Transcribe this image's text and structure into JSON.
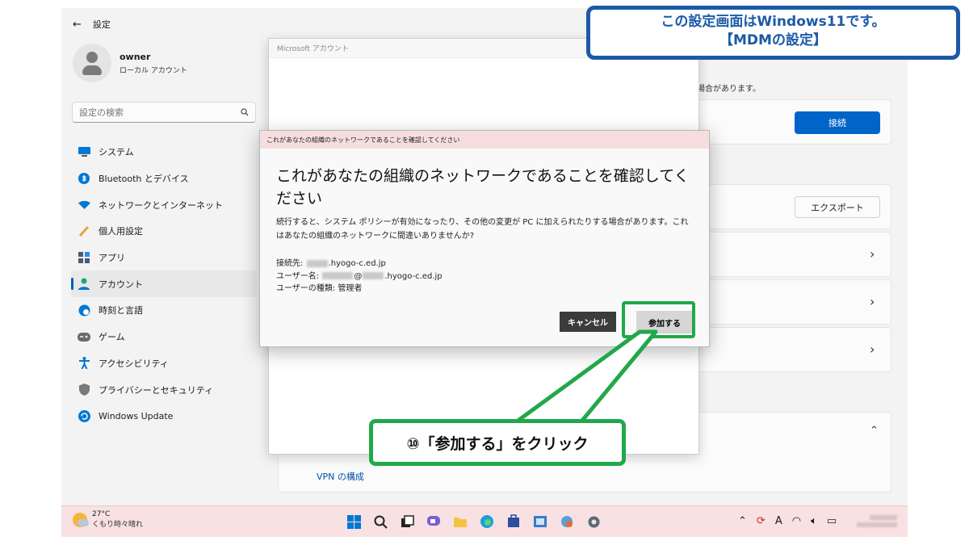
{
  "settings": {
    "back_label": "設定",
    "profile": {
      "name": "owner",
      "type": "ローカル アカウント"
    },
    "search_placeholder": "設定の検索",
    "nav": [
      {
        "label": "システム",
        "icon": "monitor-icon",
        "color": "#0078d4"
      },
      {
        "label": "Bluetooth とデバイス",
        "icon": "bluetooth-icon",
        "color": "#0078d4"
      },
      {
        "label": "ネットワークとインターネット",
        "icon": "wifi-icon",
        "color": "#0078d4"
      },
      {
        "label": "個人用設定",
        "icon": "brush-icon",
        "color": "#e8a33d"
      },
      {
        "label": "アプリ",
        "icon": "apps-icon",
        "color": "#4a5a78"
      },
      {
        "label": "アカウント",
        "icon": "person-icon",
        "color": "#1fa67a",
        "active": true
      },
      {
        "label": "時刻と言語",
        "icon": "globe-clock-icon",
        "color": "#0078d4"
      },
      {
        "label": "ゲーム",
        "icon": "gamepad-icon",
        "color": "#6b6b6b"
      },
      {
        "label": "アクセシビリティ",
        "icon": "accessibility-icon",
        "color": "#0078d4"
      },
      {
        "label": "プライバシーとセキュリティ",
        "icon": "shield-icon",
        "color": "#7a7a7a"
      },
      {
        "label": "Windows Update",
        "icon": "update-icon",
        "color": "#0078d4"
      }
    ],
    "hint_text": "場合があります。",
    "connect_label": "接続",
    "export_label": "エクスポート",
    "vpn_label": "VPN の構成"
  },
  "ms_account_window": {
    "title": "Microsoft アカウント"
  },
  "dialog": {
    "titlebar": "これがあなたの組織のネットワークであることを確認してください",
    "heading": "これがあなたの組織のネットワークであることを確認してください",
    "body": "続行すると、システム ポリシーが有効になったり、その他の変更が PC に加えられたりする場合があります。これはあなたの組織のネットワークに間違いありませんか?",
    "connect_to_label": "接続先:",
    "connect_to_domain": ".hyogo-c.ed.jp",
    "user_label": "ユーザー名:",
    "user_at": "@",
    "user_domain": ".hyogo-c.ed.jp",
    "user_type_label": "ユーザーの種類:",
    "user_type_value": "管理者",
    "cancel_label": "キャンセル",
    "join_label": "参加する"
  },
  "annotations": {
    "note_line1": "この設定画面はWindows11です。",
    "note_line2": "【MDMの設定】",
    "callout": "⑩「参加する」をクリック",
    "highlight_color": "#21a84a",
    "note_color": "#1c5aa8"
  },
  "taskbar": {
    "weather_temp": "27°C",
    "weather_desc": "くもり時々晴れ",
    "tray_ime": "A"
  }
}
